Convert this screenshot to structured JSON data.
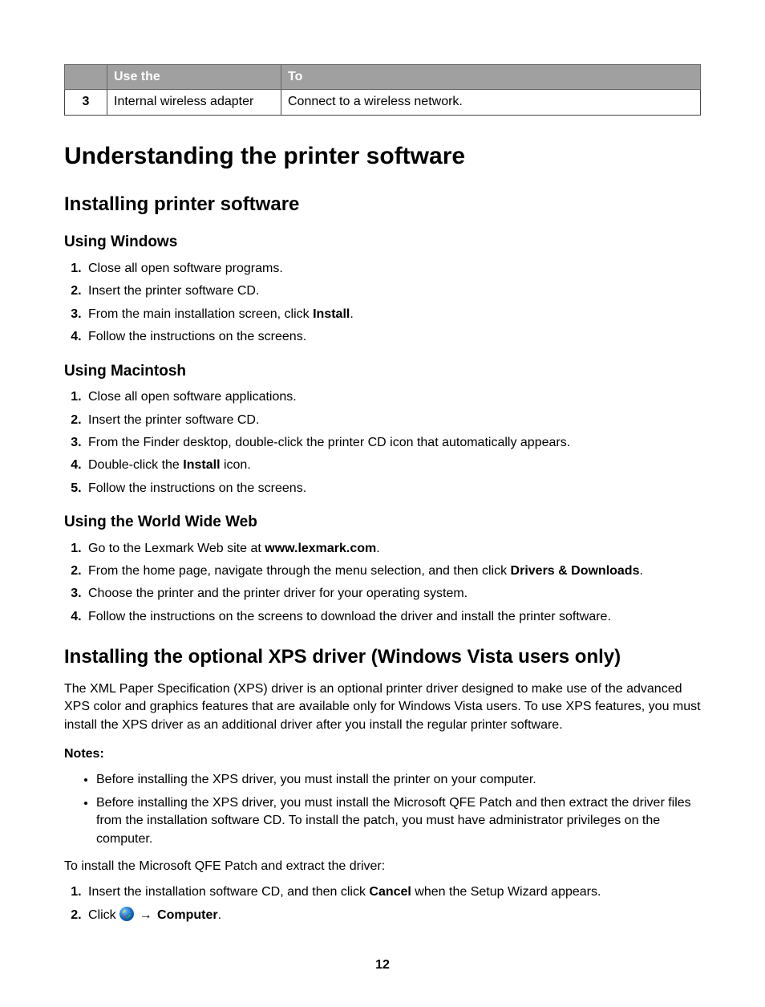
{
  "table": {
    "headers": {
      "col1": "",
      "col2": "Use the",
      "col3": "To"
    },
    "row": {
      "num": "3",
      "use": "Internal wireless adapter",
      "to": "Connect to a wireless network."
    }
  },
  "h1": "Understanding the printer software",
  "h2a": "Installing printer software",
  "windows": {
    "title": "Using Windows",
    "s1": "Close all open software programs.",
    "s2": "Insert the printer software CD.",
    "s3a": "From the main installation screen, click ",
    "s3b": "Install",
    "s3c": ".",
    "s4": "Follow the instructions on the screens."
  },
  "mac": {
    "title": "Using Macintosh",
    "s1": "Close all open software applications.",
    "s2": "Insert the printer software CD.",
    "s3": "From the Finder desktop, double-click the printer CD icon that automatically appears.",
    "s4a": "Double-click the ",
    "s4b": "Install",
    "s4c": " icon.",
    "s5": "Follow the instructions on the screens."
  },
  "www": {
    "title": "Using the World Wide Web",
    "s1a": "Go to the Lexmark Web site at ",
    "s1b": "www.lexmark.com",
    "s1c": ".",
    "s2a": "From the home page, navigate through the menu selection, and then click ",
    "s2b": "Drivers & Downloads",
    "s2c": ".",
    "s3": "Choose the printer and the printer driver for your operating system.",
    "s4": "Follow the instructions on the screens to download the driver and install the printer software."
  },
  "h2b": "Installing the optional XPS driver (Windows Vista users only)",
  "xps_intro": "The XML Paper Specification (XPS) driver is an optional printer driver designed to make use of the advanced XPS color and graphics features that are available only for Windows Vista users. To use XPS features, you must install the XPS driver as an additional driver after you install the regular printer software.",
  "notes_label": "Notes:",
  "notes": {
    "n1": "Before installing the XPS driver, you must install the printer on your computer.",
    "n2": "Before installing the XPS driver, you must install the Microsoft QFE Patch and then extract the driver files from the installation software CD. To install the patch, you must have administrator privileges on the computer."
  },
  "qfe_intro": "To install the Microsoft QFE Patch and extract the driver:",
  "qfe": {
    "s1a": "Insert the installation software CD, and then click ",
    "s1b": "Cancel",
    "s1c": " when the Setup Wizard appears.",
    "s2a": "Click ",
    "s2b": "Computer",
    "s2c": "."
  },
  "arrow": "→",
  "page": "12"
}
